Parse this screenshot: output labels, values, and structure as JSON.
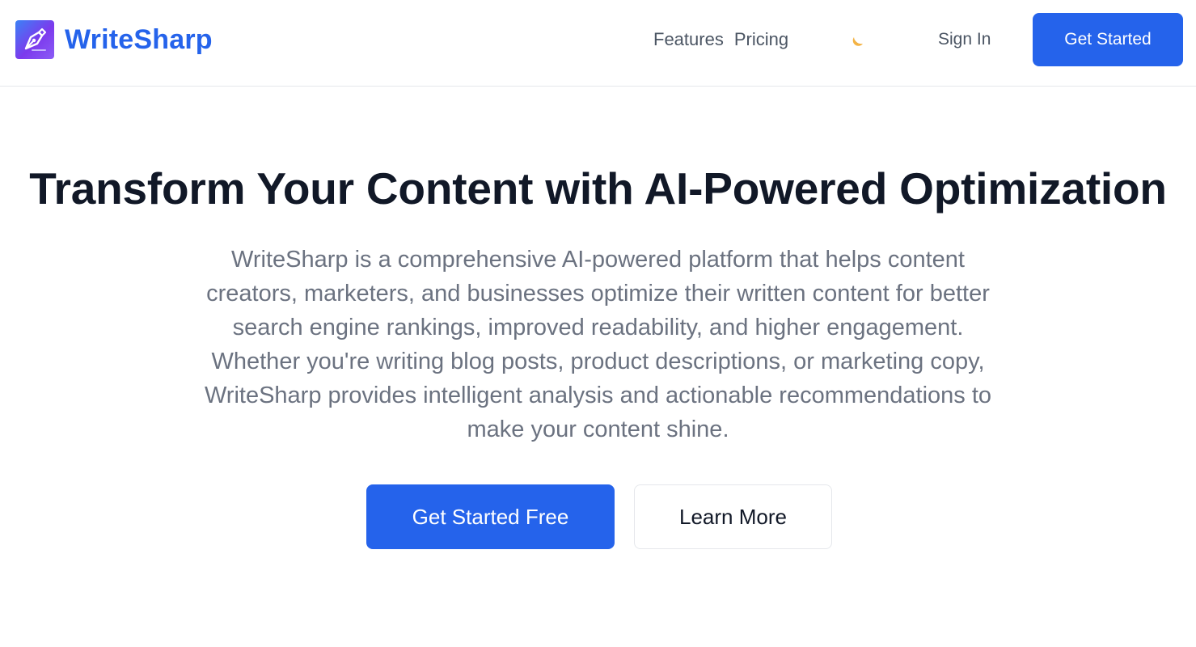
{
  "header": {
    "brand_name": "WriteSharp",
    "logo_icon": "pen-nib-icon",
    "nav": [
      {
        "label": "Features"
      },
      {
        "label": "Pricing"
      }
    ],
    "theme_toggle_icon": "moon-icon",
    "sign_in_label": "Sign In",
    "cta_label": "Get Started"
  },
  "hero": {
    "title": "Transform Your Content with AI-Powered Optimization",
    "description": "WriteSharp is a comprehensive AI-powered platform that helps content creators, marketers, and businesses optimize their written content for better search engine rankings, improved readability, and higher engagement. Whether you're writing blog posts, product descriptions, or marketing copy, WriteSharp provides intelligent analysis and actionable recommendations to make your content shine.",
    "primary_cta": "Get Started Free",
    "secondary_cta": "Learn More"
  },
  "colors": {
    "accent": "#2563eb",
    "heading": "#111827",
    "body_text": "#6b7280",
    "nav_text": "#4b5563",
    "moon": "#f5b342"
  }
}
